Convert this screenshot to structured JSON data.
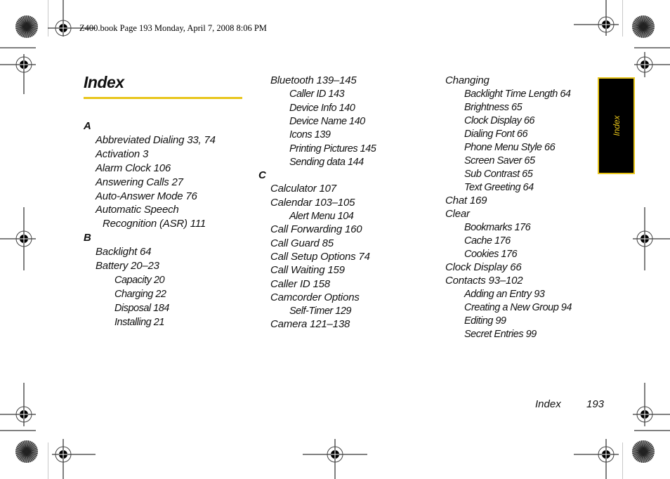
{
  "slug_line": "Z400.book  Page 193  Monday, April 7, 2008  8:06 PM",
  "page_title": "Index",
  "side_tab_label": "Index",
  "footer": {
    "label": "Index",
    "page_number": "193"
  },
  "colors": {
    "accent": "#e8c51a",
    "tab_background": "#000000"
  },
  "columns": [
    {
      "rows": [
        {
          "type": "letter",
          "text": "A"
        },
        {
          "type": "entry",
          "text": "Abbreviated Dialing 33, 74"
        },
        {
          "type": "entry",
          "text": "Activation 3"
        },
        {
          "type": "entry",
          "text": "Alarm Clock 106"
        },
        {
          "type": "entry",
          "text": "Answering Calls 27"
        },
        {
          "type": "entry",
          "text": "Auto-Answer Mode 76"
        },
        {
          "type": "entry",
          "text": "Automatic Speech"
        },
        {
          "type": "continuation",
          "text": "Recognition (ASR) 111"
        },
        {
          "type": "letter",
          "text": "B"
        },
        {
          "type": "entry",
          "text": "Backlight 64"
        },
        {
          "type": "entry",
          "text": "Battery 20–23"
        },
        {
          "type": "sub",
          "text": "Capacity 20"
        },
        {
          "type": "sub",
          "text": "Charging 22"
        },
        {
          "type": "sub",
          "text": "Disposal 184"
        },
        {
          "type": "sub",
          "text": "Installing 21"
        }
      ]
    },
    {
      "rows": [
        {
          "type": "entry",
          "text": "Bluetooth 139–145"
        },
        {
          "type": "sub",
          "text": "Caller ID 143"
        },
        {
          "type": "sub",
          "text": "Device Info 140"
        },
        {
          "type": "sub",
          "text": "Device Name 140"
        },
        {
          "type": "sub",
          "text": "Icons 139"
        },
        {
          "type": "sub",
          "text": "Printing Pictures 145"
        },
        {
          "type": "sub",
          "text": "Sending data 144"
        },
        {
          "type": "letter",
          "text": "C"
        },
        {
          "type": "entry",
          "text": "Calculator 107"
        },
        {
          "type": "entry",
          "text": "Calendar 103–105"
        },
        {
          "type": "sub",
          "text": "Alert Menu 104"
        },
        {
          "type": "entry",
          "text": "Call Forwarding 160"
        },
        {
          "type": "entry",
          "text": "Call Guard 85"
        },
        {
          "type": "entry",
          "text": "Call Setup Options 74"
        },
        {
          "type": "entry",
          "text": "Call Waiting 159"
        },
        {
          "type": "entry",
          "text": "Caller ID 158"
        },
        {
          "type": "entry",
          "text": "Camcorder Options"
        },
        {
          "type": "sub",
          "text": "Self-Timer 129"
        },
        {
          "type": "entry",
          "text": "Camera 121–138"
        }
      ]
    },
    {
      "rows": [
        {
          "type": "entry",
          "text": "Changing"
        },
        {
          "type": "sub",
          "text": "Backlight Time Length 64"
        },
        {
          "type": "sub",
          "text": "Brightness 65"
        },
        {
          "type": "sub",
          "text": "Clock Display 66"
        },
        {
          "type": "sub",
          "text": "Dialing Font 66"
        },
        {
          "type": "sub",
          "text": "Phone Menu Style 66"
        },
        {
          "type": "sub",
          "text": "Screen Saver 65"
        },
        {
          "type": "sub",
          "text": "Sub Contrast 65"
        },
        {
          "type": "sub",
          "text": "Text Greeting 64"
        },
        {
          "type": "entry",
          "text": "Chat 169"
        },
        {
          "type": "entry",
          "text": "Clear"
        },
        {
          "type": "sub",
          "text": "Bookmarks 176"
        },
        {
          "type": "sub",
          "text": "Cache 176"
        },
        {
          "type": "sub",
          "text": "Cookies 176"
        },
        {
          "type": "entry",
          "text": "Clock Display 66"
        },
        {
          "type": "entry",
          "text": "Contacts 93–102"
        },
        {
          "type": "sub",
          "text": "Adding an Entry 93"
        },
        {
          "type": "sub",
          "text": "Creating a New Group 94"
        },
        {
          "type": "sub",
          "text": "Editing 99"
        },
        {
          "type": "sub",
          "text": "Secret Entries 99"
        }
      ]
    }
  ]
}
